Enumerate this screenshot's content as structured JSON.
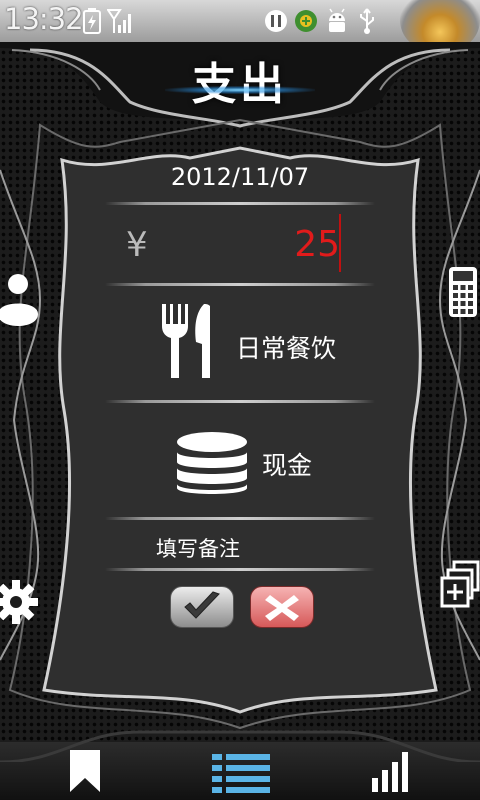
{
  "status_bar": {
    "time": "13:32",
    "icons": [
      "battery-charging-icon",
      "signal-icon",
      "pause-icon",
      "app-icon",
      "android-debug-icon",
      "usb-icon"
    ]
  },
  "header": {
    "title": "支出"
  },
  "form": {
    "date": "2012/11/07",
    "currency_symbol": "¥",
    "amount": "25",
    "category": {
      "label": "日常餐饮",
      "icon": "fork-knife-icon"
    },
    "account": {
      "label": "现金",
      "icon": "coins-stack-icon"
    },
    "note_placeholder": "填写备注",
    "confirm_icon": "checkmark-icon",
    "cancel_icon": "close-x-icon"
  },
  "side_icons": {
    "left": [
      "user-icon",
      "gear-icon"
    ],
    "right": [
      "calculator-icon",
      "add-copy-icon"
    ]
  },
  "bottom_tabs": [
    {
      "name": "bookmark-tab",
      "icon": "bookmark-icon"
    },
    {
      "name": "list-tab",
      "icon": "list-icon",
      "active": true
    },
    {
      "name": "stats-tab",
      "icon": "bar-chart-icon"
    }
  ],
  "colors": {
    "amount": "#e11b1b",
    "accent_glow": "#7fd4ff",
    "active_tab": "#5ab4e6"
  }
}
